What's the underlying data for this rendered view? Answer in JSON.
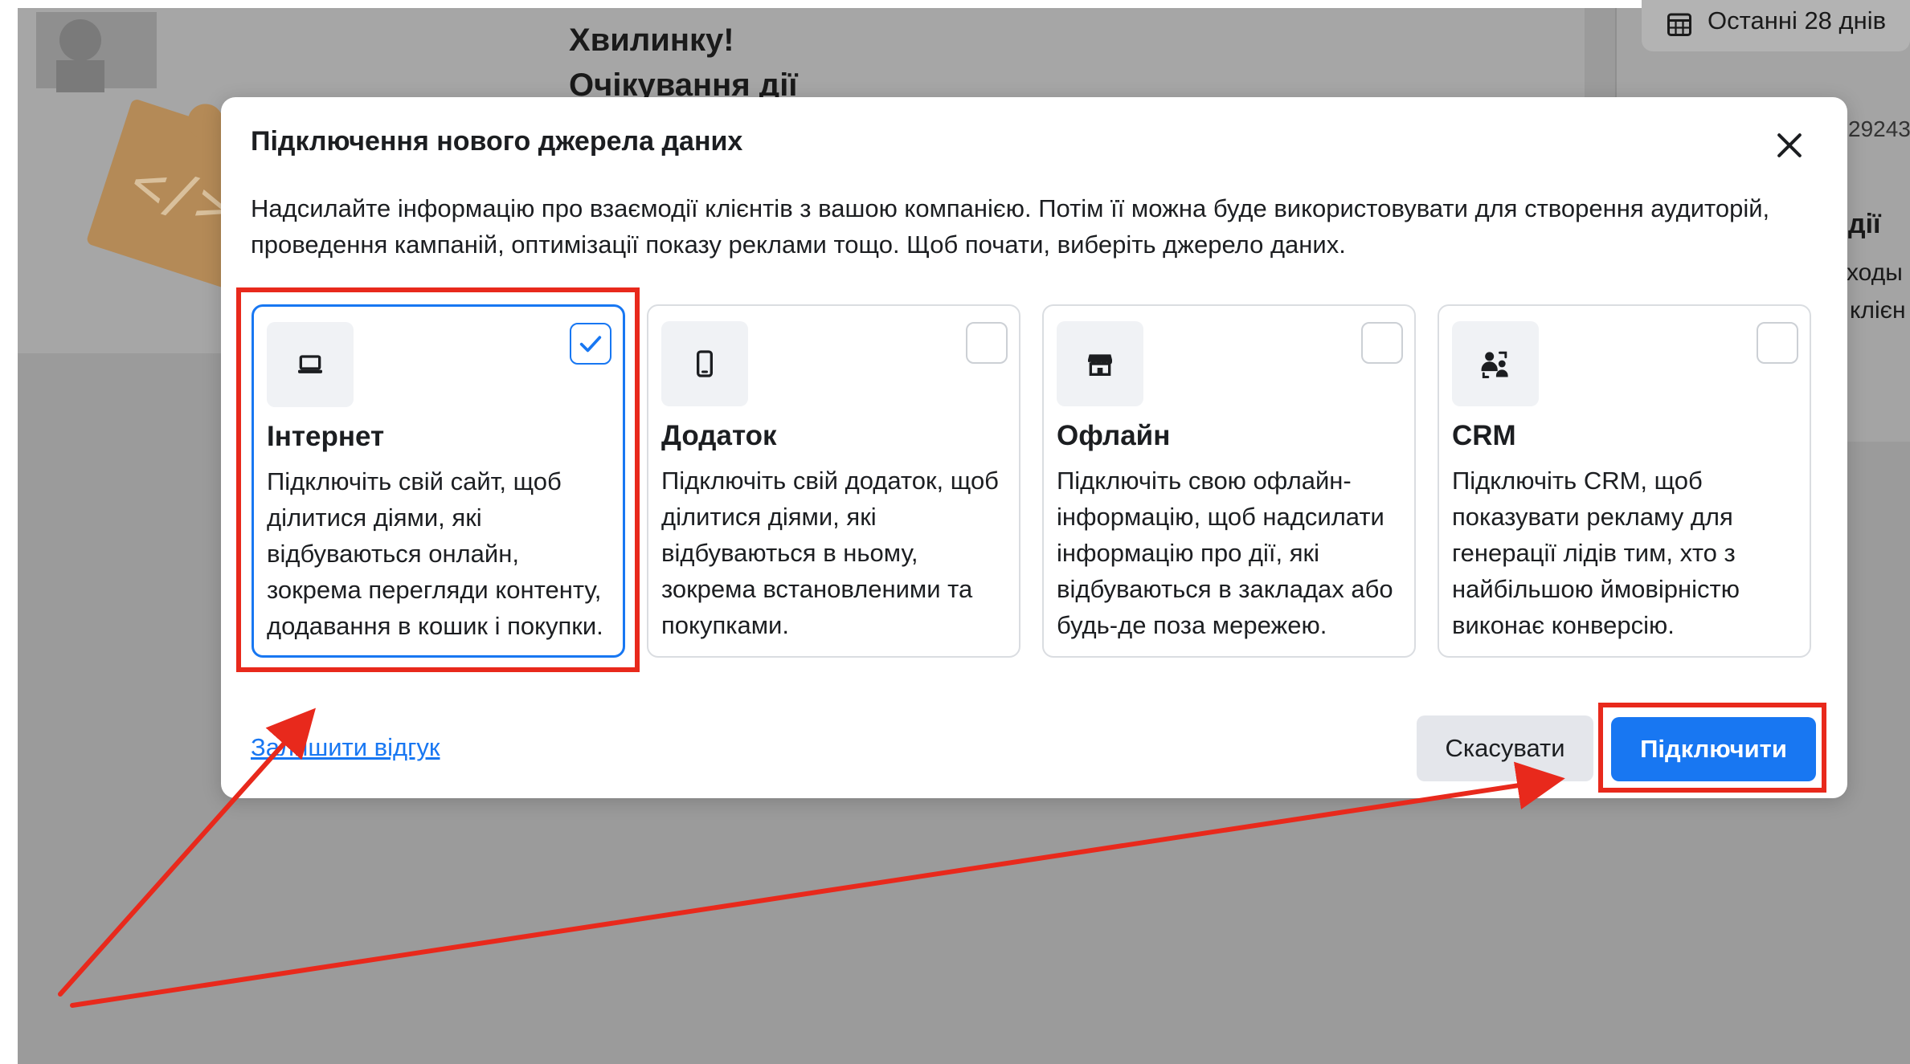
{
  "background": {
    "heading_line1": "Хвилинку!",
    "heading_line2": "Очікування дії",
    "date_range": "Останні 28 днів",
    "right_fragment_1": "29243",
    "right_fragment_2": "дії",
    "right_fragment_3": "ходы",
    "right_fragment_4": "клієн"
  },
  "modal": {
    "title": "Підключення нового джерела даних",
    "description": "Надсилайте інформацію про взаємодії клієнтів з вашою компанією. Потім її можна буде використовувати для створення аудиторій, проведення кампаній, оптимізації показу реклами тощо. Щоб почати, виберіть джерело даних.",
    "sources": [
      {
        "title": "Інтернет",
        "text": "Підключіть свій сайт, щоб ділитися діями, які відбуваються онлайн, зокрема перегляди контенту, додавання в кошик і покупки.",
        "icon": "laptop-icon",
        "selected": true
      },
      {
        "title": "Додаток",
        "text": "Підключіть свій додаток, щоб ділитися діями, які відбуваються в ньому, зокрема встановленими та покупками.",
        "icon": "mobile-phone-icon",
        "selected": false
      },
      {
        "title": "Офлайн",
        "text": "Підключіть свою офлайн-інформацію, щоб надсилати інформацію про дії, які відбуваються в закладах або будь-де поза мережею.",
        "icon": "storefront-icon",
        "selected": false
      },
      {
        "title": "CRM",
        "text": "Підключіть CRM, щоб показувати рекламу для генерації лідів тим, хто з найбільшою ймовірністю виконає конверсію.",
        "icon": "people-sync-icon",
        "selected": false
      }
    ],
    "feedback_link": "Залишити відгук",
    "cancel_label": "Скасувати",
    "connect_label": "Підключити"
  },
  "colors": {
    "accent": "#1877f2",
    "annotation": "#e8291c",
    "overlay": "#9b9b9b"
  }
}
